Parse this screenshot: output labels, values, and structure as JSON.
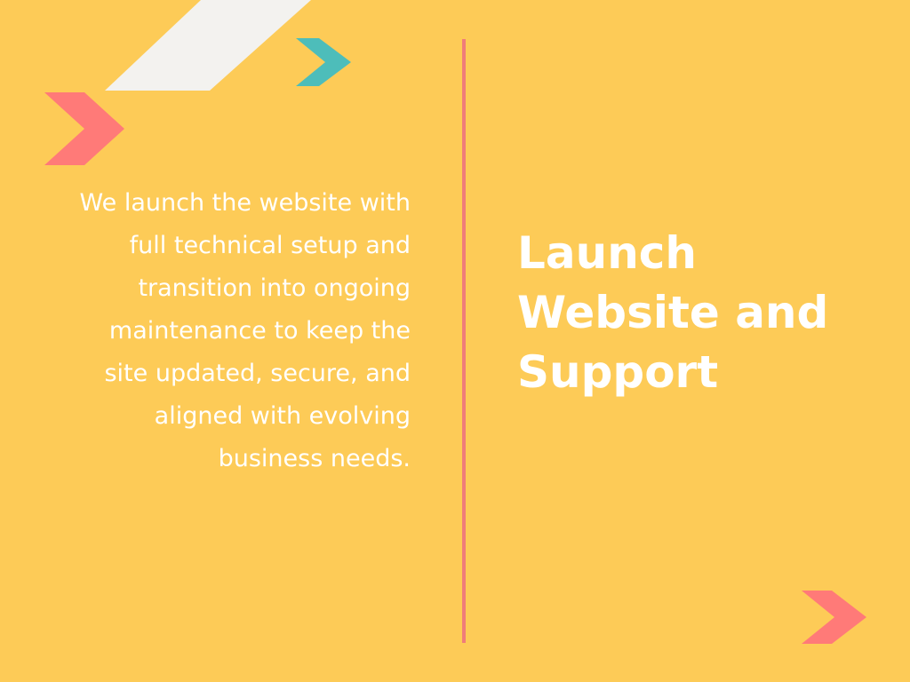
{
  "slide": {
    "title": "Launch\nWebsite and\nSupport",
    "body": "We launch the website with full technical setup and transition into ongoing maintenance to keep the site updated, secure, and aligned with evolving business needs."
  },
  "colors": {
    "background": "#FDCB57",
    "divider": "#F07C7A",
    "chevron_coral": "#FF7A78",
    "chevron_teal": "#4DBDBA",
    "stripe": "#F3F2EF",
    "text": "#FFFFFF"
  },
  "icons": {
    "top_left_chevron": "chevron-right-icon",
    "top_center_chevron": "chevron-right-icon",
    "bottom_right_chevron": "chevron-right-icon"
  }
}
